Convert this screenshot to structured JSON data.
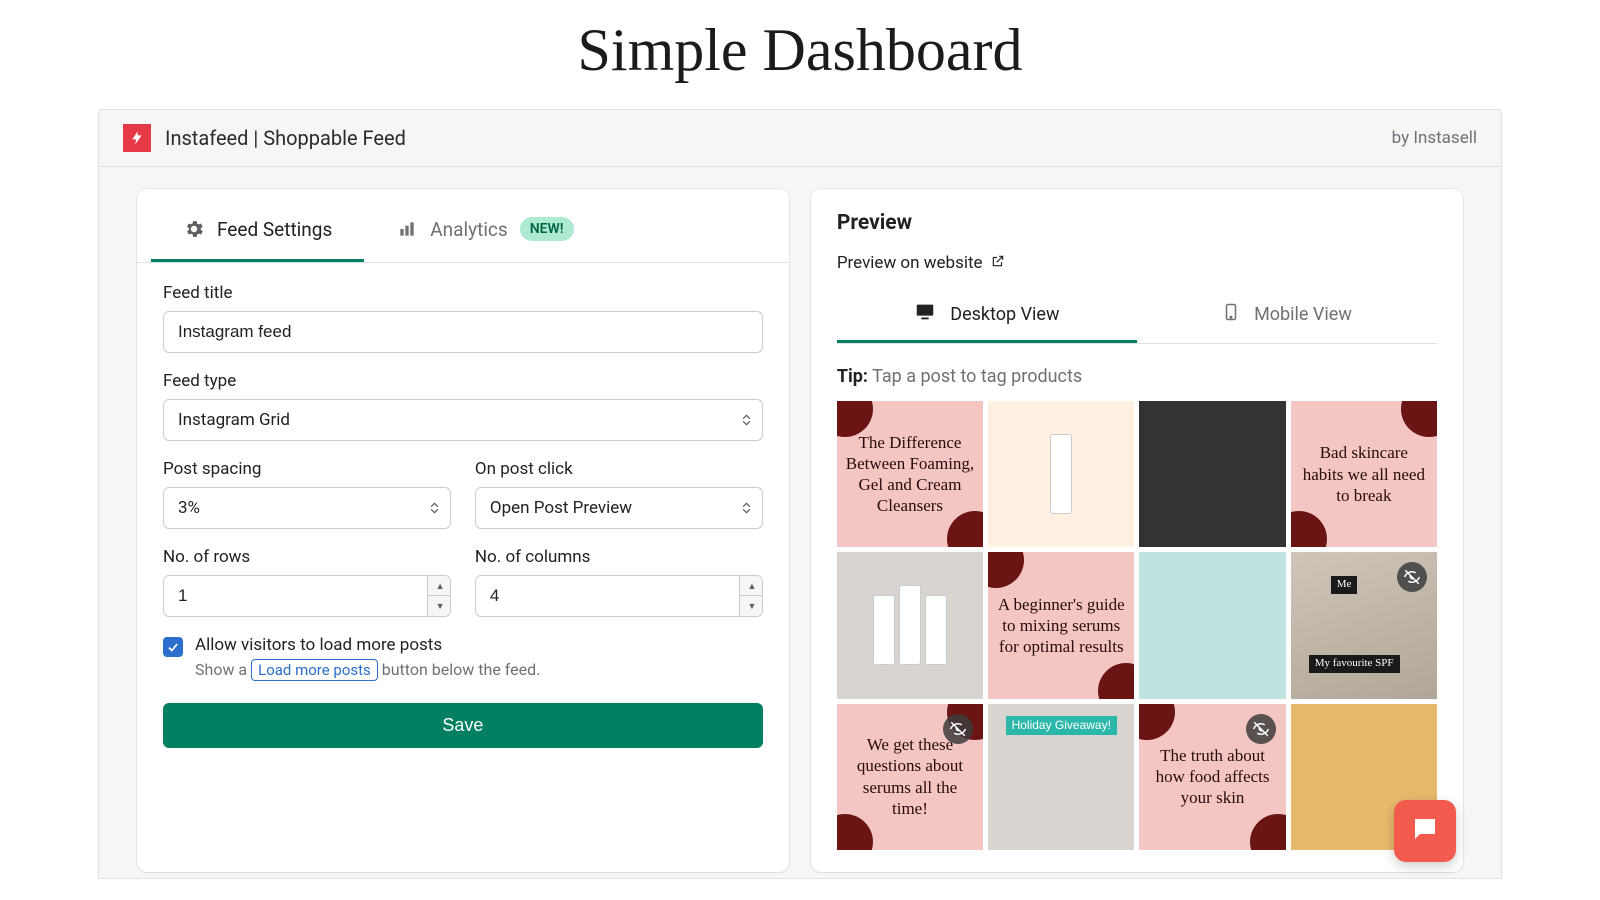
{
  "page_heading": "Simple Dashboard",
  "header": {
    "app_name": "Instafeed | Shoppable Feed",
    "by": "by Instasell"
  },
  "tabs": {
    "feed_settings": "Feed Settings",
    "analytics": "Analytics",
    "new_badge": "NEW!"
  },
  "form": {
    "feed_title_label": "Feed title",
    "feed_title_value": "Instagram feed",
    "feed_type_label": "Feed type",
    "feed_type_value": "Instagram Grid",
    "post_spacing_label": "Post spacing",
    "post_spacing_value": "3%",
    "on_post_click_label": "On post click",
    "on_post_click_value": "Open Post Preview",
    "rows_label": "No. of rows",
    "rows_value": "1",
    "cols_label": "No. of columns",
    "cols_value": "4",
    "allow_more_label": "Allow visitors to load more posts",
    "hint_prefix": "Show a",
    "hint_pill": "Load more posts",
    "hint_suffix": "button below the feed.",
    "save_label": "Save"
  },
  "preview": {
    "title": "Preview",
    "link_label": "Preview on website",
    "desktop_label": "Desktop View",
    "mobile_label": "Mobile View",
    "tip_label": "Tip:",
    "tip_text": "Tap a post to tag products",
    "tiles": [
      {
        "text": "The Difference Between Foaming, Gel and Cream Cleansers"
      },
      {
        "text": ""
      },
      {
        "text": ""
      },
      {
        "text": "Bad skincare habits we all need to break"
      },
      {
        "text": ""
      },
      {
        "text": "A beginner's guide to mixing serums for optimal results"
      },
      {
        "text": ""
      },
      {
        "text_top": "Me",
        "text_bottom": "My favourite SPF"
      },
      {
        "text": "We get these questions about serums all the time!"
      },
      {
        "text": "Holiday Giveaway!"
      },
      {
        "text": "The truth about how food affects your skin"
      },
      {
        "text": ""
      }
    ]
  }
}
